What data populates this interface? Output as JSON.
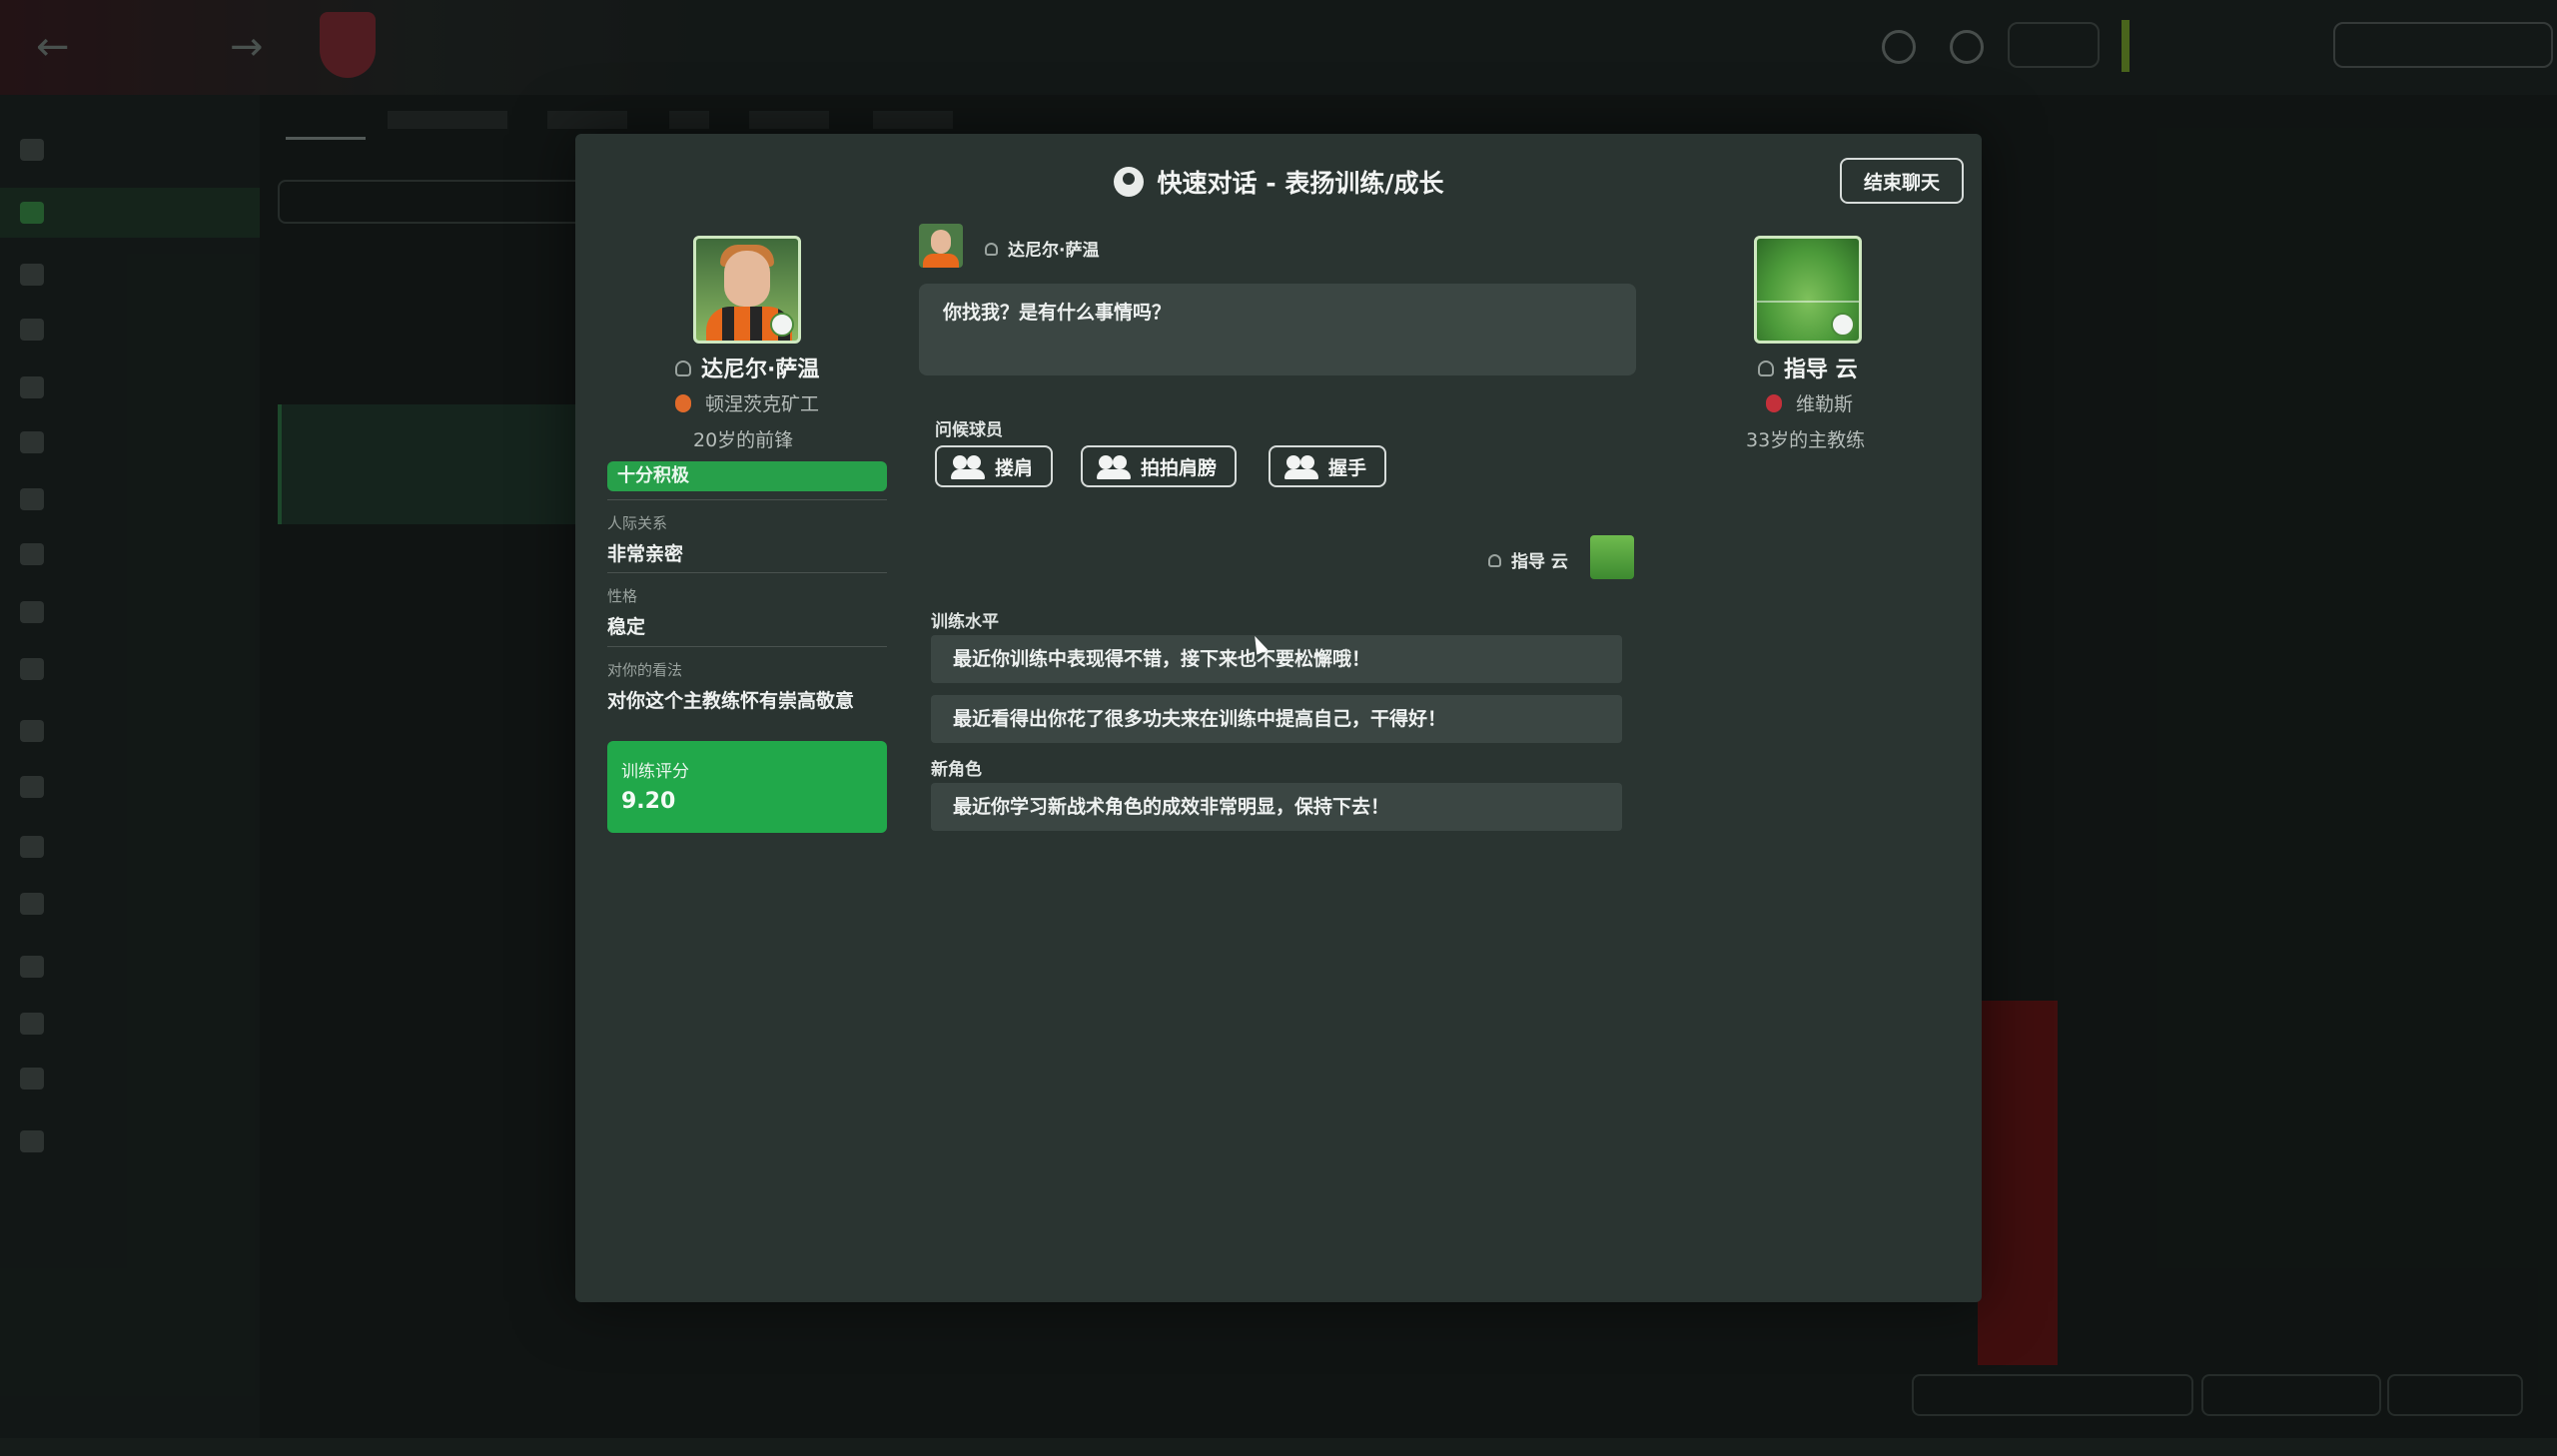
{
  "modal": {
    "title": "快速对话 - 表扬训练/成长",
    "end_chat_label": "结束聊天"
  },
  "player": {
    "name": "达尼尔·萨温",
    "club": "顿涅茨克矿工",
    "age_role": "20岁的前锋",
    "mood": "十分积极",
    "relationship_label": "人际关系",
    "relationship_value": "非常亲密",
    "personality_label": "性格",
    "personality_value": "稳定",
    "opinion_label": "对你的看法",
    "opinion_value": "对你这个主教练怀有崇高敬意",
    "rating_label": "训练评分",
    "rating_value": "9.20"
  },
  "coach": {
    "name": "指导 云",
    "club": "维勒斯",
    "age_role": "33岁的主教练"
  },
  "chat": {
    "player_speaker": "达尼尔·萨温",
    "player_message": "你找我？是有什么事情吗？",
    "greeting_section": "问候球员",
    "gestures": [
      {
        "label": "搂肩",
        "icon": "two-people-icon"
      },
      {
        "label": "拍拍肩膀",
        "icon": "two-people-icon"
      },
      {
        "label": "握手",
        "icon": "handshake-icon"
      }
    ],
    "coach_speaker": "指导 云",
    "training_section": "训练水平",
    "training_options": [
      "最近你训练中表现得不错，接下来也不要松懈哦！",
      "最近看得出你花了很多功夫来在训练中提高自己，干得好！"
    ],
    "new_role_section": "新角色",
    "new_role_options": [
      "最近你学习新战术角色的成效非常明显，保持下去！"
    ]
  },
  "colors": {
    "modal_bg": "#2a3431",
    "accent_green": "#21a84a",
    "option_bg": "#3b4643"
  }
}
